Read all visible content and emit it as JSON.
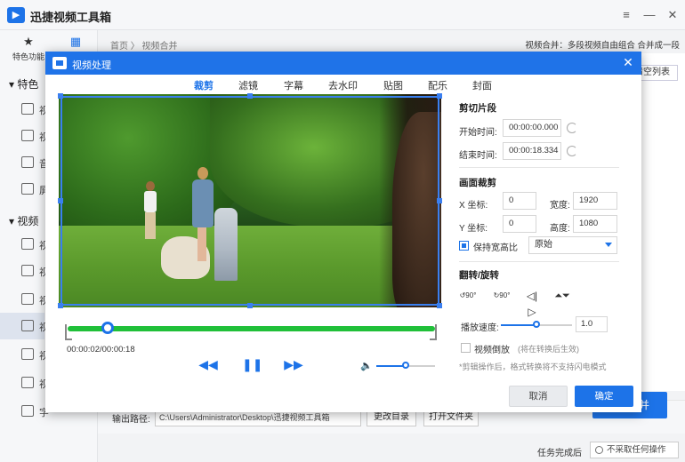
{
  "app": {
    "name": "迅捷视频工具箱",
    "window_controls": [
      "≡",
      "—",
      "✕"
    ]
  },
  "sidebar": {
    "tabs": [
      {
        "label": "特色功能",
        "icon": "star-icon"
      },
      {
        "label": "",
        "icon": "video-icon"
      }
    ],
    "categories": [
      "特色",
      "视频"
    ],
    "items": [
      {
        "label": "视",
        "icon": "video-edit-icon"
      },
      {
        "label": "视",
        "icon": "video-icon"
      },
      {
        "label": "音",
        "icon": "audio-icon"
      },
      {
        "label": "屏",
        "icon": "screen-icon"
      },
      {
        "label": "视",
        "icon": "video-icon"
      },
      {
        "label": "视",
        "icon": "video-icon"
      },
      {
        "label": "视",
        "icon": "video-icon"
      },
      {
        "label": "视",
        "icon": "video-merge-icon"
      },
      {
        "label": "视",
        "icon": "gif-icon"
      },
      {
        "label": "视",
        "icon": "music-icon"
      },
      {
        "label": "字",
        "icon": "text-icon"
      }
    ]
  },
  "breadcrumb": "首页 〉 视频合并",
  "hint": "视频合并：多段视频自由组合 合并成一段",
  "clear_list_label": "清空列表",
  "output": {
    "path_label": "输出路径:",
    "path_value": "C:\\Users\\Administrator\\Desktop\\迅捷视频工具箱",
    "change_dir_label": "更改目录",
    "open_folder_label": "打开文件夹"
  },
  "merge_button_label": "并",
  "task": {
    "label": "任务完成后",
    "select_value": "不采取任何操作"
  },
  "dialog": {
    "title": "视频处理",
    "close": "✕",
    "tabs": [
      "裁剪",
      "滤镜",
      "字幕",
      "去水印",
      "贴图",
      "配乐",
      "封面"
    ],
    "active_tab": "裁剪",
    "clip": {
      "section_title": "剪切片段",
      "start_label": "开始时间:",
      "start_value": "00:00:00.000",
      "end_label": "结束时间:",
      "end_value": "00:00:18.334"
    },
    "crop": {
      "section_title": "画面裁剪",
      "x_label": "X 坐标:",
      "x_value": "0",
      "width_label": "宽度:",
      "width_value": "1920",
      "y_label": "Y 坐标:",
      "y_value": "0",
      "height_label": "高度:",
      "height_value": "1080",
      "keep_ratio_label": "保持宽高比",
      "keep_ratio_checked": true,
      "ratio_value": "原始"
    },
    "rotate": {
      "section_title": "翻转/旋转",
      "buttons": [
        "90°",
        "90°",
        "",
        ""
      ]
    },
    "speed": {
      "label": "播放速度:",
      "value": "1.0",
      "fraction": 0.5
    },
    "reverse": {
      "label": "视频倒放",
      "note": "(将在转换后生效)",
      "checked": false
    },
    "tip": "*剪辑操作后，格式转换将不支持闪电模式",
    "playback": {
      "time": "00:00:02/00:00:18",
      "progress": 0.11,
      "volume": 0.5
    },
    "cancel_label": "取消",
    "ok_label": "确定"
  },
  "colors": {
    "accent": "#1d73e8",
    "timeline": "#20c039"
  }
}
